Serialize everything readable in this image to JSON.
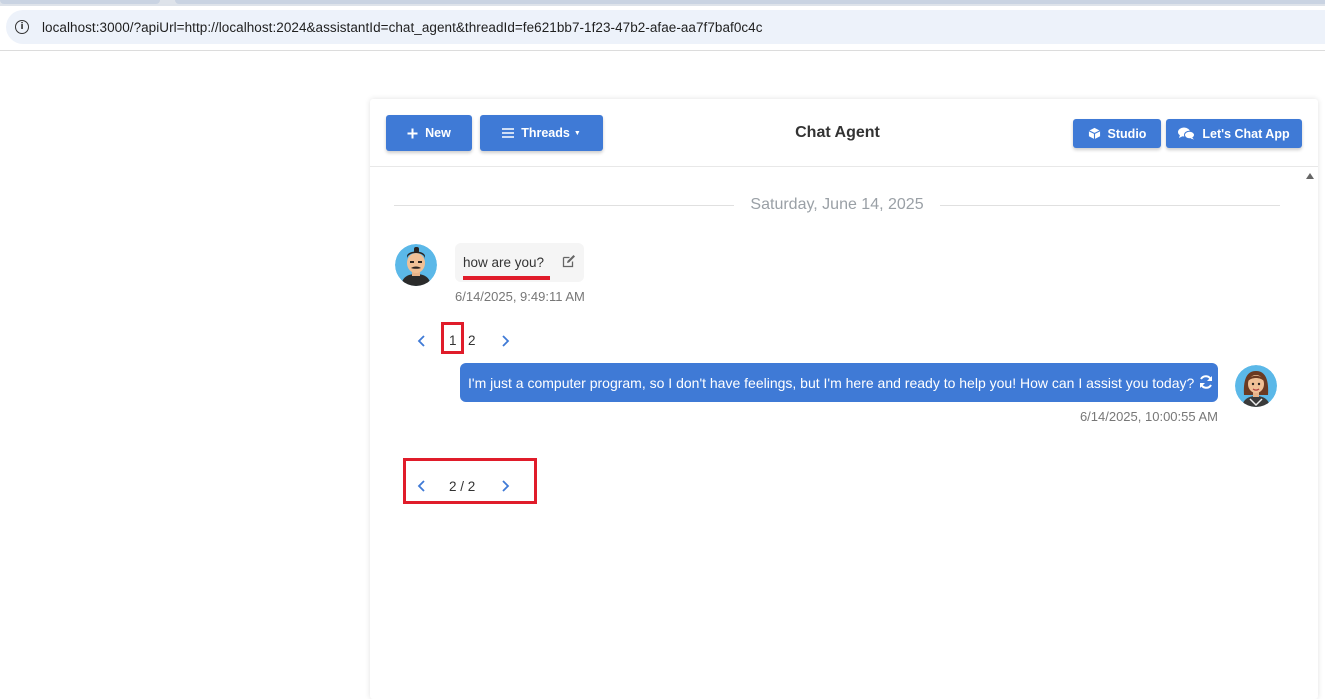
{
  "browser": {
    "url": "localhost:3000/?apiUrl=http://localhost:2024&assistantId=chat_agent&threadId=fe621bb7-1f23-47b2-afae-aa7f7baf0c4c",
    "info_icon": "info-icon"
  },
  "header": {
    "new_label": "New",
    "threads_label": "Threads",
    "title": "Chat Agent",
    "studio_label": "Studio",
    "chat_app_label": "Let's Chat App"
  },
  "conversation": {
    "date": "Saturday, June 14, 2025",
    "user_message": {
      "text": "how are you?",
      "time": "6/14/2025, 9:49:11 AM"
    },
    "branch_pager": {
      "pages": [
        "1",
        "2"
      ],
      "current": "1"
    },
    "bot_message": {
      "text": "I'm just a computer program, so I don't have feelings, but I'm here and ready to help you! How can I assist you today?",
      "time": "6/14/2025, 10:00:55 AM"
    },
    "response_pager": {
      "label": "2 / 2"
    }
  },
  "colors": {
    "accent": "#3f7ad6",
    "highlight": "#e01c2a"
  }
}
